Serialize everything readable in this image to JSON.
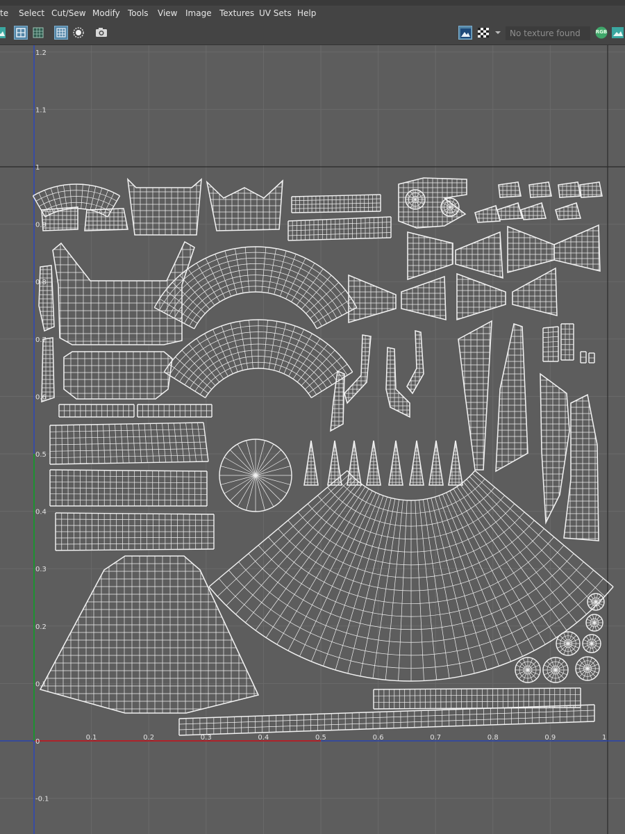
{
  "menu": [
    "te",
    "Select",
    "Cut/Sew",
    "Modify",
    "Tools",
    "View",
    "Image",
    "Textures",
    "UV Sets",
    "Help"
  ],
  "toolbar": {
    "texture_field_placeholder": "No texture found",
    "rgb_label": "RGB",
    "icons": [
      "image-icon",
      "uv-grid-icon",
      "uv-lattice-icon",
      "uv-shell-grid-icon",
      "shaded-sphere-icon",
      "snapshot-icon",
      "display-image-icon",
      "checker-icon",
      "chevron-down-icon",
      "rgb-channels-icon",
      "image-icon"
    ]
  },
  "viewport": {
    "v_ticks": [
      "1.2",
      "1.1",
      "1",
      "0.9",
      "0.8",
      "0.7",
      "0.6",
      "0.5",
      "0.4",
      "0.3",
      "0.2",
      "0.1",
      "0",
      "-0.1"
    ],
    "u_ticks": [
      "0.1",
      "0.2",
      "0.3",
      "0.4",
      "0.5",
      "0.6",
      "0.7",
      "0.8",
      "0.9",
      "1"
    ],
    "u_axis_color": "#d01010",
    "v_axis_color": "#2040d0",
    "v_axis_green_color": "#10a020",
    "grid_color": "#6a6a6a",
    "uv_wire_color": "#f2f2f2",
    "background_color": "#5d5d5d"
  }
}
